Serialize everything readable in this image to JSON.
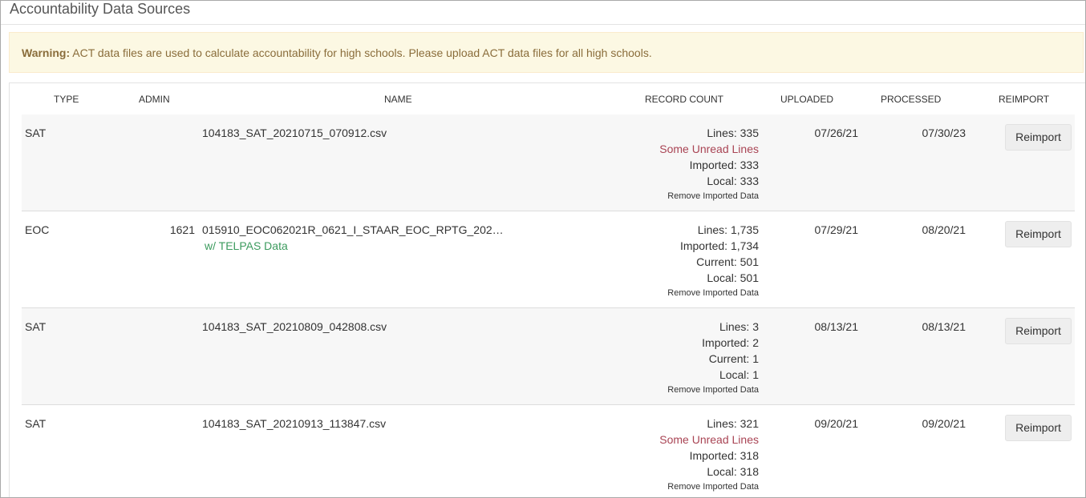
{
  "page": {
    "title": "Accountability Data Sources"
  },
  "warning": {
    "label": "Warning:",
    "message": " ACT data files are used to calculate accountability for high schools. Please upload ACT data files for all high schools."
  },
  "table": {
    "headers": {
      "type": "TYPE",
      "admin": "ADMIN",
      "name": "NAME",
      "record_count": "RECORD COUNT",
      "uploaded": "UPLOADED",
      "processed": "PROCESSED",
      "reimport": "REIMPORT"
    },
    "rows": [
      {
        "type": "SAT",
        "admin": "",
        "name": "104183_SAT_20210715_070912.csv",
        "name_sub": "",
        "counts": [
          "Lines: 335",
          "Some Unread Lines",
          "Imported: 333",
          "Local: 333"
        ],
        "remove": "Remove Imported Data",
        "uploaded": "07/26/21",
        "processed": "07/30/23",
        "button": "Reimport"
      },
      {
        "type": "EOC",
        "admin": "1621",
        "name": "015910_EOC062021R_0621_I_STAAR_EOC_RPTG_202…",
        "name_sub": "w/ TELPAS Data",
        "counts": [
          "Lines: 1,735",
          "Imported: 1,734",
          "Current: 501",
          "Local: 501"
        ],
        "remove": "Remove Imported Data",
        "uploaded": "07/29/21",
        "processed": "08/20/21",
        "button": "Reimport"
      },
      {
        "type": "SAT",
        "admin": "",
        "name": "104183_SAT_20210809_042808.csv",
        "name_sub": "",
        "counts": [
          "Lines: 3",
          "Imported: 2",
          "Current: 1",
          "Local: 1"
        ],
        "remove": "Remove Imported Data",
        "uploaded": "08/13/21",
        "processed": "08/13/21",
        "button": "Reimport"
      },
      {
        "type": "SAT",
        "admin": "",
        "name": "104183_SAT_20210913_113847.csv",
        "name_sub": "",
        "counts": [
          "Lines: 321",
          "Some Unread Lines",
          "Imported: 318",
          "Local: 318"
        ],
        "remove": "Remove Imported Data",
        "uploaded": "09/20/21",
        "processed": "09/20/21",
        "button": "Reimport"
      }
    ]
  },
  "colors": {
    "warning_bg": "#fcf8e3",
    "warning_text": "#8a6d3b",
    "unread_text": "#a94454",
    "telpas_text": "#3c9b5e",
    "row_stripe": "#f7f7f7"
  }
}
